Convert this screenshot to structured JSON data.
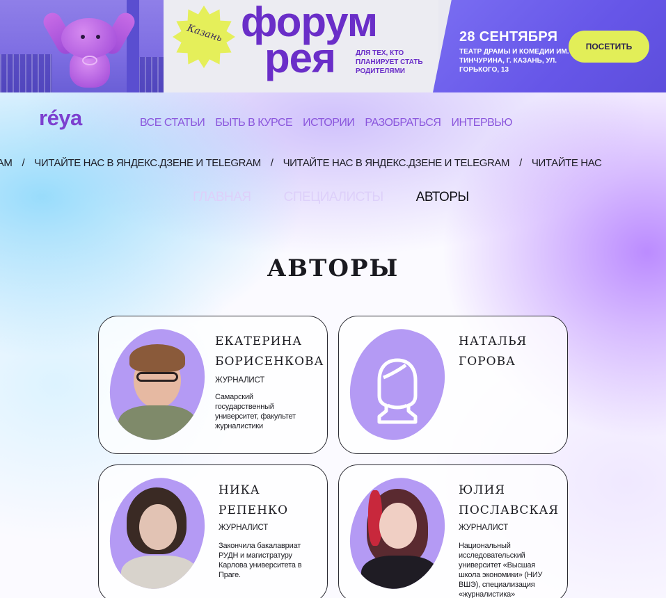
{
  "banner": {
    "city": "Казань",
    "title_line1": "форум",
    "title_line2": "рея",
    "subtitle": "ДЛЯ ТЕХ, КТО ПЛАНИРУЕТ СТАТЬ РОДИТЕЛЯМИ",
    "date": "28 СЕНТЯБРЯ",
    "venue": "ТЕАТР ДРАМЫ И КОМЕДИИ ИМ. ТИНЧУРИНА, Г. КАЗАНЬ, УЛ. ГОРЬКОГО, 13",
    "cta": "ПОСЕТИТЬ"
  },
  "header": {
    "logo": "réya",
    "nav": [
      "ВСЕ СТАТЬИ",
      "БЫТЬ В КУРСЕ",
      "ИСТОРИИ",
      "РАЗОБРАТЬСЯ",
      "ИНТЕРВЬЮ"
    ]
  },
  "ticker": {
    "items": [
      "И TELEGRAM",
      "ЧИТАЙТЕ НАС В ЯНДЕКС.ДЗЕНЕ И TELEGRAM",
      "ЧИТАЙТЕ НАС В ЯНДЕКС.ДЗЕНЕ И TELEGRAM",
      "ЧИТАЙТЕ НАС"
    ],
    "separator": "/"
  },
  "breadcrumbs": {
    "items": [
      "ГЛАВНАЯ",
      "СПЕЦИАЛИСТЫ"
    ],
    "current": "АВТОРЫ"
  },
  "page": {
    "title": "АВТОРЫ"
  },
  "authors": [
    {
      "name_line1": "ЕКАТЕРИНА",
      "name_line2": "БОРИСЕНКОВА",
      "role": "ЖУРНАЛИСТ",
      "description": "Самарский государственный университет, факультет журналистики"
    },
    {
      "name_line1": "НАТАЛЬЯ",
      "name_line2": "ГОРОВА",
      "role": "",
      "description": ""
    },
    {
      "name_line1": "НИКА",
      "name_line2": "РЕПЕНКО",
      "role": "ЖУРНАЛИСТ",
      "description": "Закончила бакалавриат РУДН и магистратуру Карлова университета в Праге."
    },
    {
      "name_line1": "ЮЛИЯ",
      "name_line2": "ПОСЛАВСКАЯ",
      "role": "ЖУРНАЛИСТ",
      "description": "Национальный исследовательский университет «Высшая школа экономики» (НИУ ВШЭ), специализация «журналистика»"
    }
  ],
  "colors": {
    "accent": "#8a55dc",
    "brand": "#7c3fcf",
    "photo_bg": "#b49af4",
    "cta_bg": "#e2ee58"
  }
}
